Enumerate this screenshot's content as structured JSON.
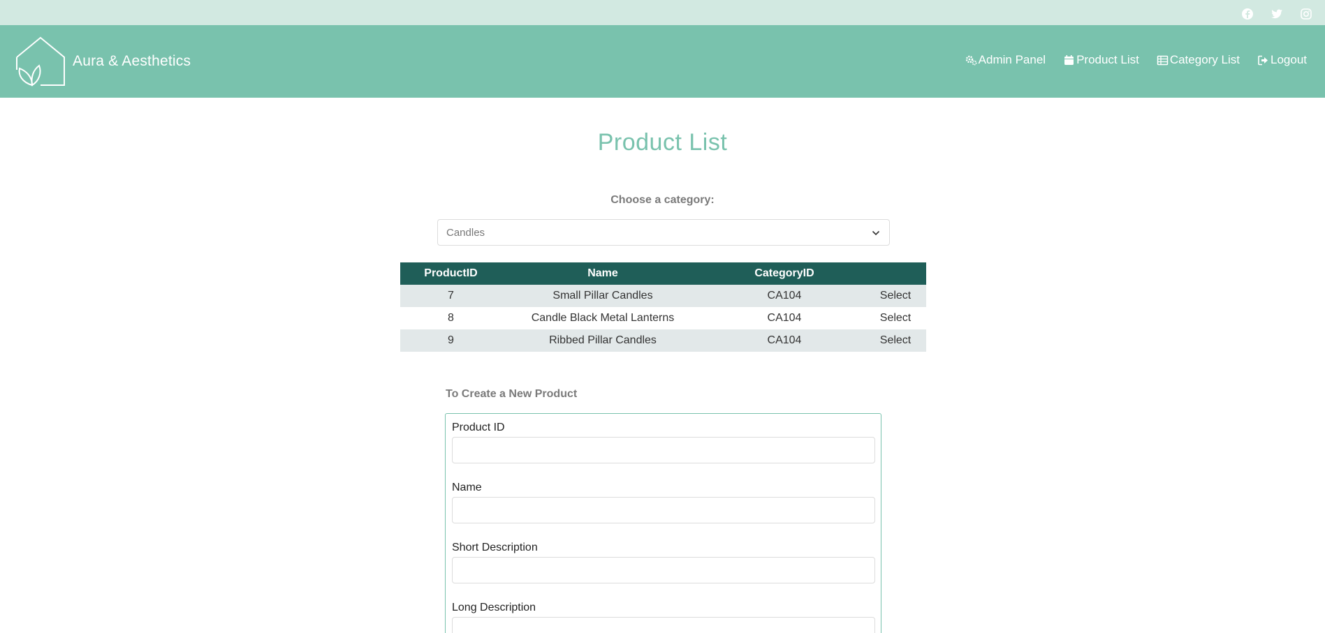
{
  "social": {
    "icons": [
      "facebook-icon",
      "twitter-icon",
      "instagram-icon"
    ]
  },
  "brand": {
    "name": "Aura & Aesthetics",
    "logo": "house-leaf-logo"
  },
  "nav": {
    "items": [
      {
        "label": "Admin Panel",
        "icon": "gears-icon"
      },
      {
        "label": "Product List",
        "icon": "calendar-icon"
      },
      {
        "label": "Category List",
        "icon": "table-icon"
      },
      {
        "label": "Logout",
        "icon": "logout-icon"
      }
    ]
  },
  "page": {
    "title": "Product List",
    "choose_label": "Choose a category:",
    "category_selected": "Candles"
  },
  "table": {
    "headers": [
      "ProductID",
      "Name",
      "CategoryID",
      ""
    ],
    "rows": [
      {
        "id": "7",
        "name": "Small Pillar Candles",
        "category": "CA104",
        "action": "Select"
      },
      {
        "id": "8",
        "name": "Candle Black Metal Lanterns",
        "category": "CA104",
        "action": "Select"
      },
      {
        "id": "9",
        "name": "Ribbed Pillar Candles",
        "category": "CA104",
        "action": "Select"
      }
    ]
  },
  "form": {
    "heading": "To Create a New Product",
    "fields": [
      {
        "label": "Product ID",
        "value": ""
      },
      {
        "label": "Name",
        "value": ""
      },
      {
        "label": "Short Description",
        "value": ""
      },
      {
        "label": "Long Description",
        "value": ""
      }
    ]
  },
  "colors": {
    "topbar": "#d2e9e1",
    "navbar": "#79c2ad",
    "table_header": "#1f5e58",
    "row_stripe": "#e2e8e9",
    "accent": "#79c2ad"
  }
}
